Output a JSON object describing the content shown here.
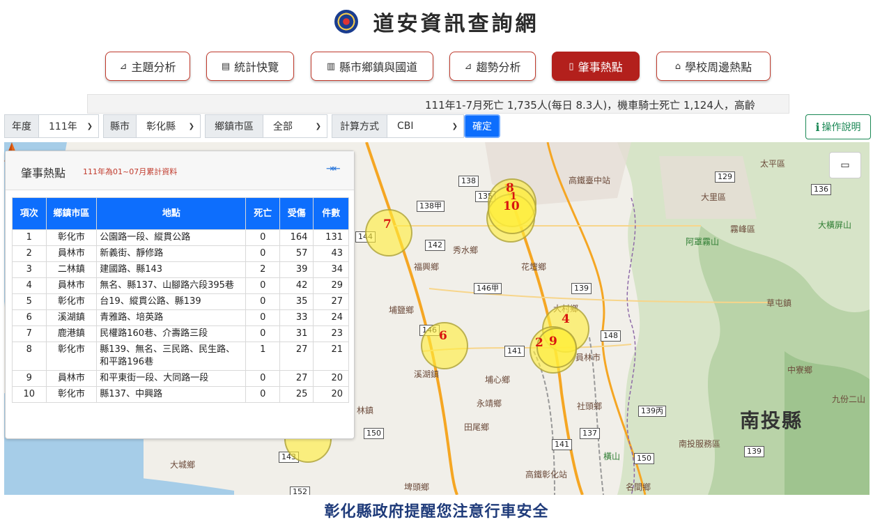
{
  "header": {
    "title": "道安資訊查詢網"
  },
  "nav": [
    {
      "label": "主題分析",
      "icon": "chart-line-icon",
      "glyph": "⌂"
    },
    {
      "label": "統計快覽",
      "icon": "list-card-icon",
      "glyph": "▤"
    },
    {
      "label": "縣市鄉鎮與國道",
      "icon": "bar-chart-icon",
      "glyph": "▥"
    },
    {
      "label": "趨勢分析",
      "icon": "trend-icon",
      "glyph": "⌂"
    },
    {
      "label": "肇事熱點",
      "icon": "map-icon",
      "glyph": "▯"
    },
    {
      "label": "學校周邊熱點",
      "icon": "school-icon",
      "glyph": "⌂"
    }
  ],
  "marquee": "111年1-7月死亡 1,735人(每日 8.3人)，機車騎士死亡 1,124人，高齡",
  "filters": {
    "year_label": "年度",
    "year_value": "111年",
    "county_label": "縣市",
    "county_value": "彰化縣",
    "town_label": "鄉鎮市區",
    "town_value": "全部",
    "method_label": "計算方式",
    "method_value": "CBI",
    "confirm": "確定"
  },
  "help": {
    "label": "操作說明"
  },
  "panel": {
    "title": "肇事熱點",
    "subtitle": "111年為01~07月累計資料",
    "headers": [
      "項次",
      "鄉鎮市區",
      "地點",
      "死亡",
      "受傷",
      "件數"
    ],
    "rows": [
      {
        "rank": "1",
        "town": "彰化市",
        "place": "公園路一段、縱貫公路",
        "dead": "0",
        "injured": "164",
        "count": "131"
      },
      {
        "rank": "2",
        "town": "員林市",
        "place": "新義街、靜修路",
        "dead": "0",
        "injured": "57",
        "count": "43"
      },
      {
        "rank": "3",
        "town": "二林鎮",
        "place": "建國路、縣143",
        "dead": "2",
        "injured": "39",
        "count": "34"
      },
      {
        "rank": "4",
        "town": "員林市",
        "place": "無名、縣137、山腳路六段395巷",
        "dead": "0",
        "injured": "42",
        "count": "29"
      },
      {
        "rank": "5",
        "town": "彰化市",
        "place": "台19、縱貫公路、縣139",
        "dead": "0",
        "injured": "35",
        "count": "27"
      },
      {
        "rank": "6",
        "town": "溪湖鎮",
        "place": "青雅路、培英路",
        "dead": "0",
        "injured": "33",
        "count": "24"
      },
      {
        "rank": "7",
        "town": "鹿港鎮",
        "place": "民權路160巷、介壽路三段",
        "dead": "0",
        "injured": "31",
        "count": "23"
      },
      {
        "rank": "8",
        "town": "彰化市",
        "place": "縣139、無名、三民路、民生路、和平路196巷",
        "dead": "1",
        "injured": "27",
        "count": "21"
      },
      {
        "rank": "9",
        "town": "員林市",
        "place": "和平東街一段、大同路一段",
        "dead": "0",
        "injured": "27",
        "count": "20"
      },
      {
        "rank": "10",
        "town": "彰化市",
        "place": "縣137、中興路",
        "dead": "0",
        "injured": "25",
        "count": "20"
      }
    ]
  },
  "map": {
    "hotspot_labels": [
      "8",
      "1",
      "10",
      "7",
      "4",
      "2",
      "9",
      "6"
    ],
    "place_names": {
      "hsr_taichung": "高鐵臺中站",
      "taiping": "太平區",
      "dali": "大里區",
      "wufeng": "霧峰區",
      "alishan_wufeng": "阿罩霧山",
      "dakeng": "大橫屏山",
      "caotun": "草屯鎮",
      "zhongliao": "中寮鄉",
      "jiufen": "九份二山",
      "nantou": "南投縣",
      "nantou_service": "南投服務區",
      "xiushui": "秀水鄉",
      "fuxing": "福興鄉",
      "huatan": "花壇鄉",
      "dacun": "大村鄉",
      "puyan": "埔鹽鄉",
      "xihu": "溪湖鎮",
      "puxin": "埔心鄉",
      "yuanlin": "員林市",
      "yongjing": "永靖鄉",
      "shetou": "社頭鄉",
      "tianwei": "田尾鄉",
      "hsr_changhua": "高鐵彰化站",
      "dacheng": "大城鄉",
      "pitou": "埤頭鄉",
      "mingjian": "名間鄉",
      "lin": "林鎮",
      "hengshan": "橫山"
    },
    "roads": [
      "138",
      "135",
      "138甲",
      "142",
      "144",
      "146甲",
      "139",
      "146",
      "141",
      "148",
      "137",
      "150",
      "143",
      "152",
      "129",
      "136",
      "139丙",
      "141",
      "150",
      "139"
    ]
  },
  "footer": "彰化縣政府提醒您注意行車安全"
}
